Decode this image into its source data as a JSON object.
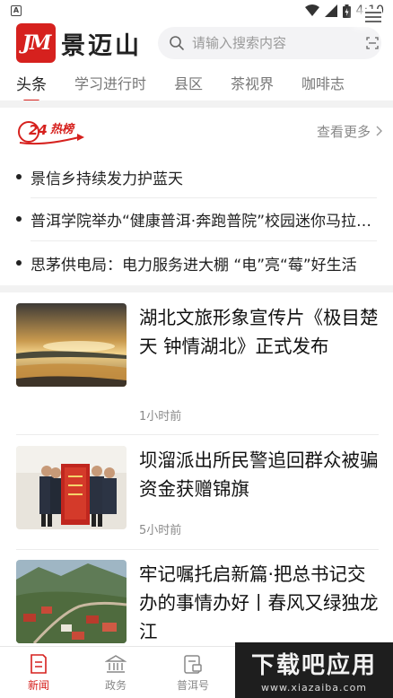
{
  "status_bar": {
    "time": "4:10",
    "left_icon_letter": "A"
  },
  "header": {
    "logo_text": "景迈山",
    "logo_mark": "JM",
    "search_placeholder": "请输入搜索内容"
  },
  "tabs": [
    {
      "label": "头条",
      "active": true
    },
    {
      "label": "学习进行时",
      "active": false
    },
    {
      "label": "县区",
      "active": false
    },
    {
      "label": "茶视界",
      "active": false
    },
    {
      "label": "咖啡志",
      "active": false
    }
  ],
  "hot": {
    "logo_label": "热榜",
    "logo_number": "24",
    "more_label": "查看更多",
    "items": [
      "景信乡持续发力护蓝天",
      "普洱学院举办“健康普洱·奔跑普院”校园迷你马拉松活动",
      "思茅供电局：电力服务进大棚 “电”亮“莓”好生活"
    ]
  },
  "articles": [
    {
      "title": "湖北文旅形象宣传片《极目楚天 钟情湖北》正式发布",
      "time": "1小时前",
      "thumb": "river-sunset"
    },
    {
      "title": "坝溜派出所民警追回群众被骗资金获赠锦旗",
      "time": "5小时前",
      "thumb": "police-banner"
    },
    {
      "title": "牢记嘱托启新篇·把总书记交办的事情办好丨春风又绿独龙江",
      "time": "",
      "thumb": "mountain-village"
    }
  ],
  "bottom_nav": [
    {
      "label": "新闻",
      "icon": "news-icon",
      "active": true
    },
    {
      "label": "政务",
      "icon": "government-icon",
      "active": false
    },
    {
      "label": "普洱号",
      "icon": "puer-account-icon",
      "active": false
    }
  ],
  "watermark": {
    "title": "下载吧应用",
    "url": "www.xiazaiba.com"
  },
  "colors": {
    "brand_red": "#d6211e",
    "text_primary": "#222222",
    "text_secondary": "#888888",
    "divider": "#f2f2f2"
  }
}
